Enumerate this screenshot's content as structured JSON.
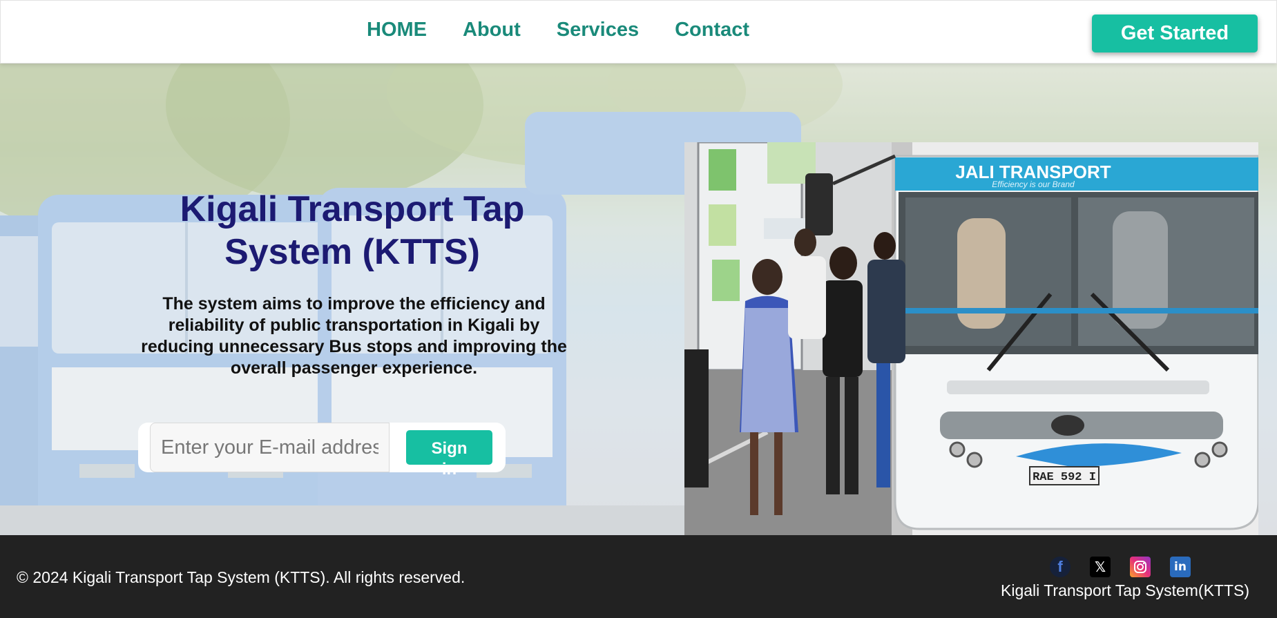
{
  "header": {
    "nav": [
      {
        "label": "HOME"
      },
      {
        "label": "About"
      },
      {
        "label": "Services"
      },
      {
        "label": "Contact"
      }
    ],
    "cta_label": "Get Started"
  },
  "hero": {
    "title": "Kigali Transport Tap System (KTTS)",
    "description": "The system aims to improve the efficiency and reliability of public transportation in Kigali by reducing unnecessary Bus stops and improving the overall passenger experience.",
    "email_placeholder": "Enter your E-mail address",
    "signin_label": "Sign in",
    "photo": {
      "bus_brand": "JALI TRANSPORT",
      "bus_slogan": "Efficiency is our Brand",
      "plate": "RAE 592 I"
    }
  },
  "footer": {
    "copyright": "© 2024 Kigali Transport Tap System (KTTS). All rights reserved.",
    "brand": "Kigali Transport Tap System(KTTS)",
    "socials": [
      {
        "icon": "facebook-icon",
        "glyph": "f"
      },
      {
        "icon": "x-icon",
        "glyph": "𝕏"
      },
      {
        "icon": "instagram-icon",
        "glyph": ""
      },
      {
        "icon": "linkedin-icon",
        "glyph": "in"
      }
    ]
  },
  "colors": {
    "accent": "#17bfa2",
    "nav_text": "#1a8a7a",
    "title": "#1c1a72",
    "footer_bg": "#222222"
  }
}
